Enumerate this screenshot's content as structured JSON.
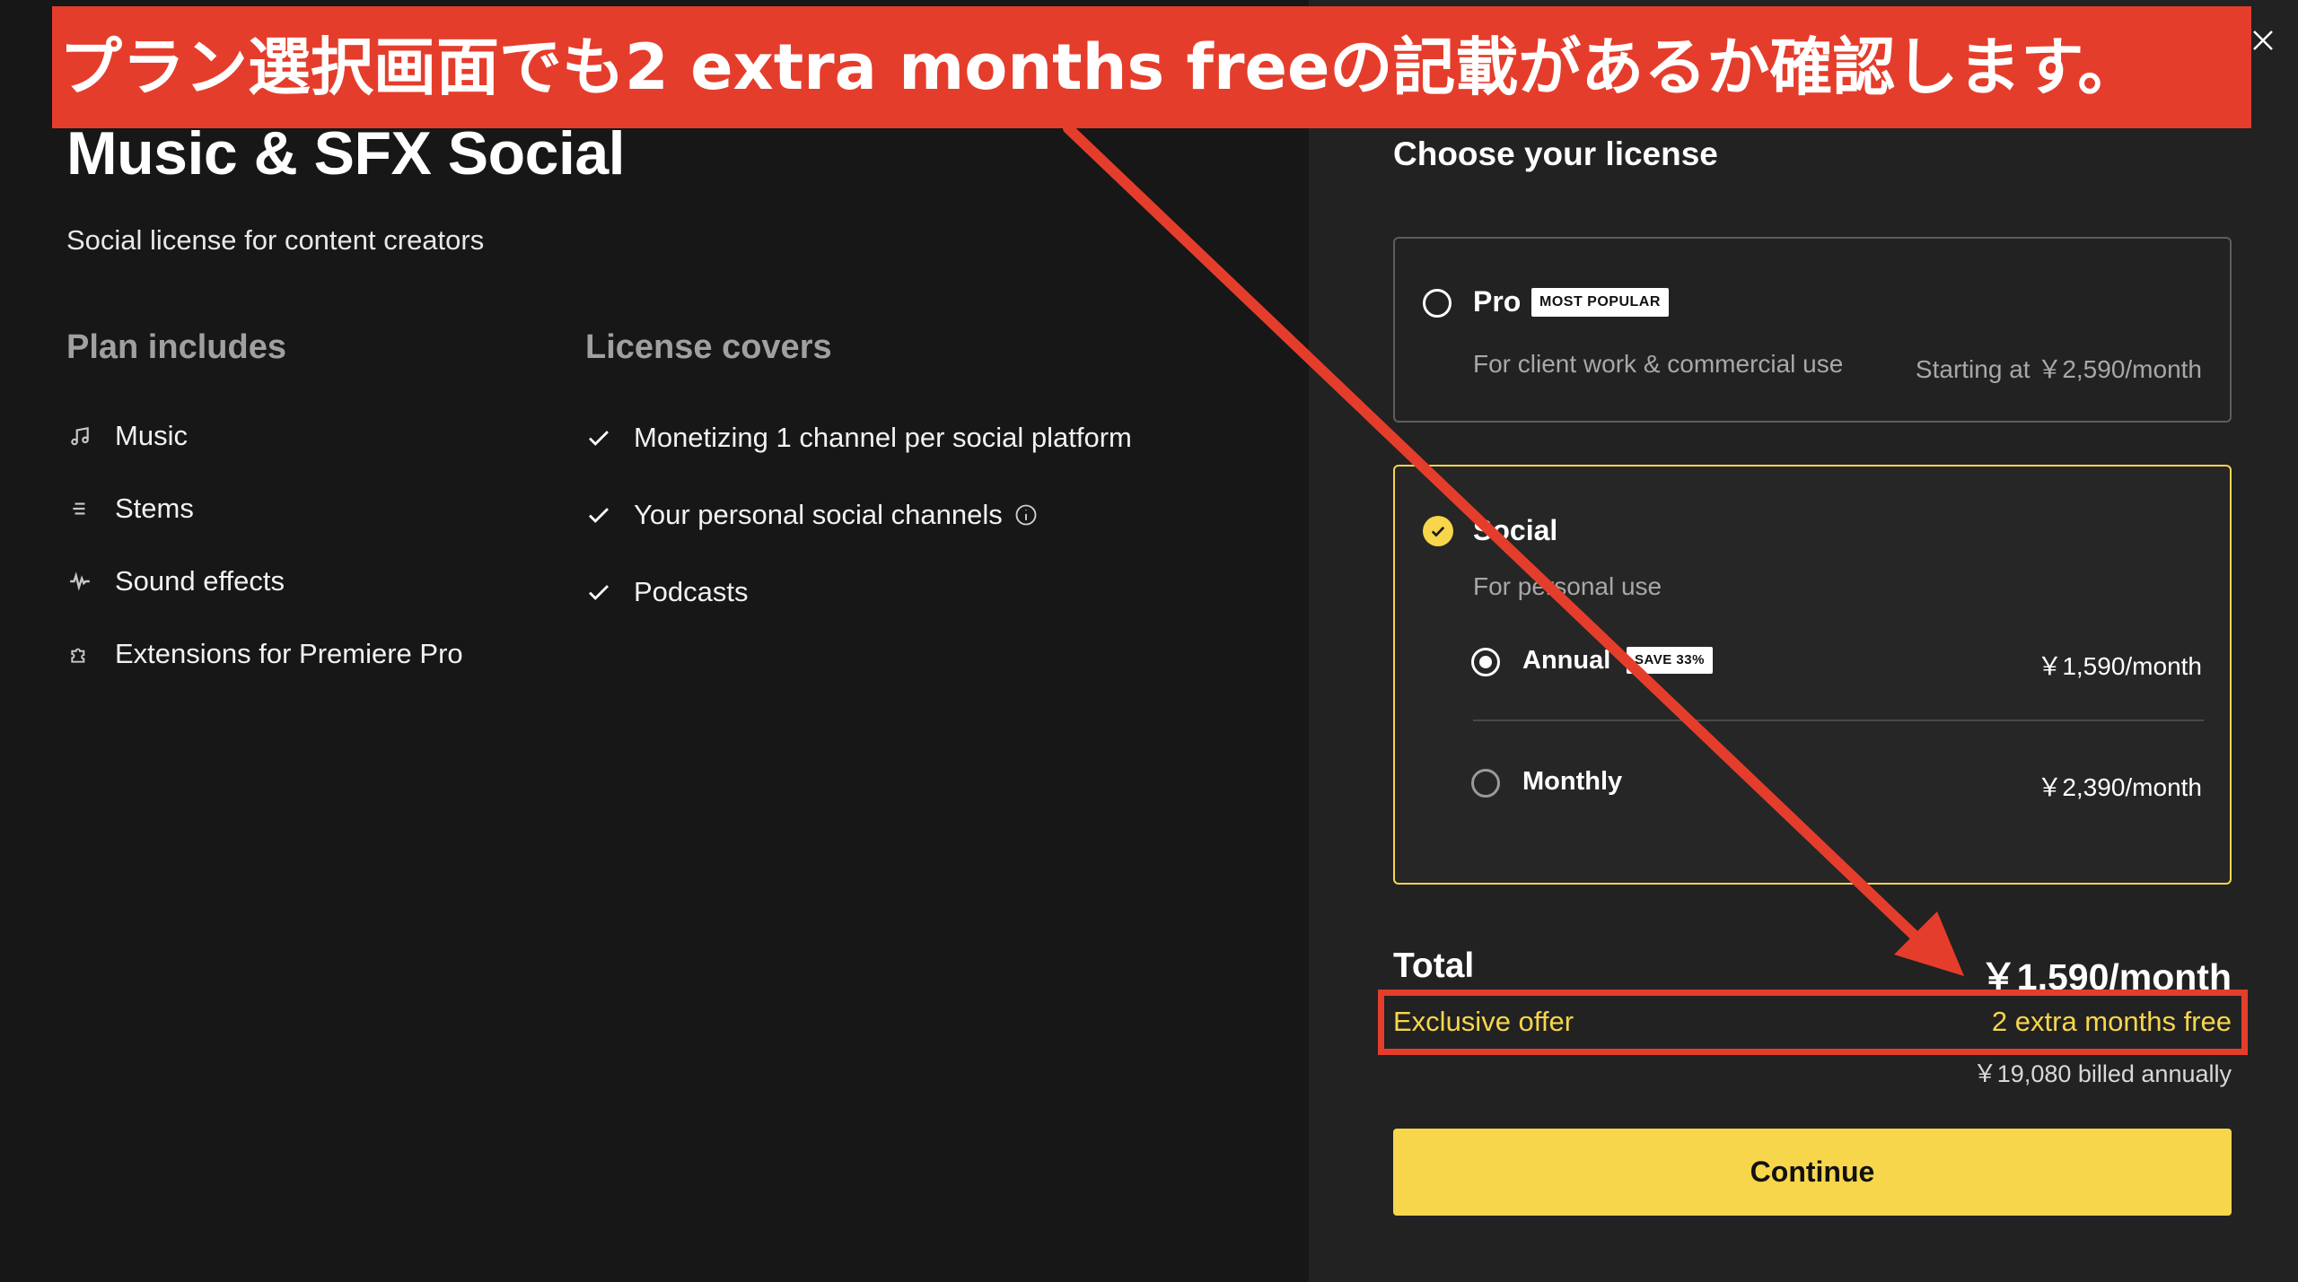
{
  "plan": {
    "title": "Music & SFX Social",
    "subtitle": "Social license for content creators"
  },
  "plan_includes": {
    "heading": "Plan includes",
    "items": [
      {
        "label": "Music",
        "icon": "music-note-icon"
      },
      {
        "label": "Stems",
        "icon": "stems-icon"
      },
      {
        "label": "Sound effects",
        "icon": "waveform-icon"
      },
      {
        "label": "Extensions for Premiere Pro",
        "icon": "puzzle-icon"
      }
    ]
  },
  "license_covers": {
    "heading": "License covers",
    "items": [
      {
        "label": "Monetizing 1 channel per social platform",
        "icon": "checkmark-icon"
      },
      {
        "label": "Your personal social channels",
        "icon": "checkmark-icon",
        "info": true
      },
      {
        "label": "Podcasts",
        "icon": "checkmark-icon"
      }
    ]
  },
  "license": {
    "heading": "Choose your license",
    "pro": {
      "name": "Pro",
      "badge": "MOST POPULAR",
      "description": "For client work & commercial use",
      "price": "Starting at ￥2,590/month",
      "selected": false
    },
    "social": {
      "name": "Social",
      "description": "For personal use",
      "selected": true,
      "options": [
        {
          "label": "Annual",
          "badge": "SAVE 33%",
          "price": "￥1,590/month",
          "selected": true
        },
        {
          "label": "Monthly",
          "price": "￥2,390/month",
          "selected": false
        }
      ]
    }
  },
  "summary": {
    "total_label": "Total",
    "total_value": "￥1,590/month",
    "offer_label": "Exclusive offer",
    "offer_value": "2 extra months free",
    "billed": "￥19,080 billed annually"
  },
  "continue_label": "Continue",
  "annotation": {
    "text": "プラン選択画面でも2 extra months freeの記載があるか確認します。"
  },
  "colors": {
    "accent": "#f7d64b",
    "annotation": "#e53d2c",
    "background": "#171717",
    "panel": "#222222"
  }
}
